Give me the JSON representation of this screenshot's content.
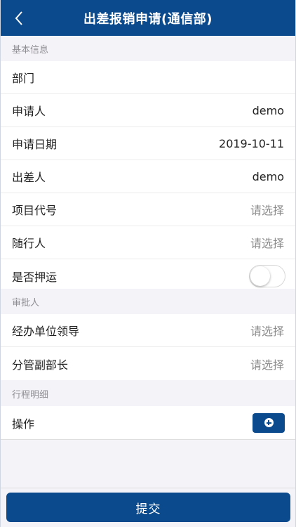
{
  "header": {
    "title": "出差报销申请(通信部)"
  },
  "sections": {
    "basic": {
      "title": "基本信息",
      "rows": [
        {
          "label": "部门",
          "value": ""
        },
        {
          "label": "申请人",
          "value": "demo"
        },
        {
          "label": "申请日期",
          "value": "2019-10-11"
        },
        {
          "label": "出差人",
          "value": "demo"
        },
        {
          "label": "项目代号",
          "placeholder": "请选择"
        },
        {
          "label": "随行人",
          "placeholder": "请选择"
        },
        {
          "label": "是否押运",
          "toggle": false
        }
      ]
    },
    "approver": {
      "title": "审批人",
      "rows": [
        {
          "label": "经办单位领导",
          "placeholder": "请选择"
        },
        {
          "label": "分管副部长",
          "placeholder": "请选择"
        }
      ]
    },
    "itinerary": {
      "title": "行程明细",
      "rows": [
        {
          "label": "操作",
          "icon": "add-circle-icon"
        }
      ]
    }
  },
  "footer": {
    "submit_label": "提交"
  },
  "colors": {
    "primary": "#0b4a8c",
    "background": "#f4f3f8"
  }
}
